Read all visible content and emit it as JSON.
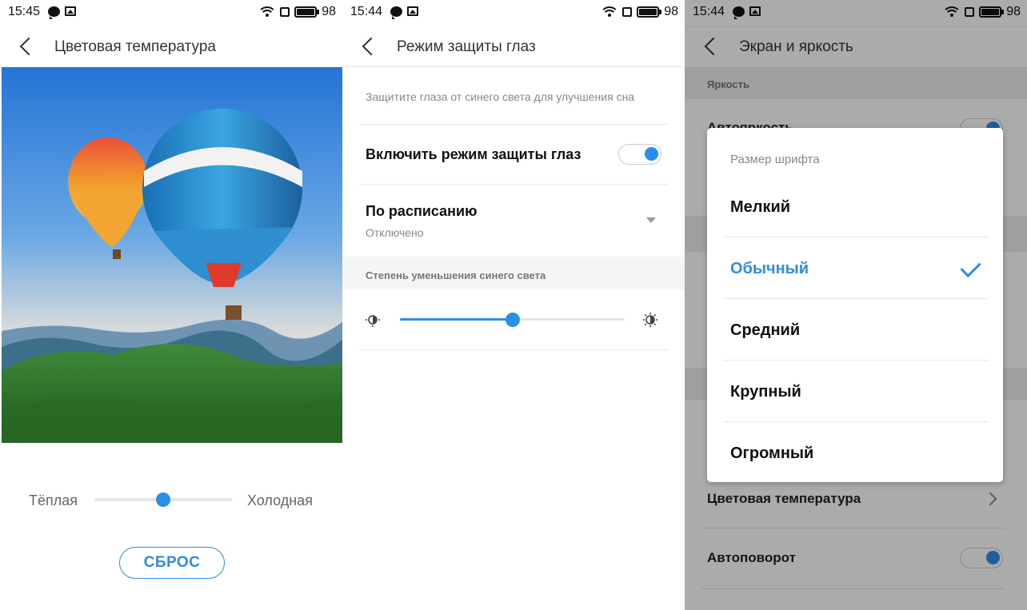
{
  "panel1": {
    "status": {
      "time": "15:45",
      "battery": "98"
    },
    "title": "Цветовая температура",
    "warm_label": "Тёплая",
    "cold_label": "Холодная",
    "temp_slider": 0.5,
    "reset_label": "СБРОС"
  },
  "panel2": {
    "status": {
      "time": "15:44",
      "battery": "98"
    },
    "title": "Режим защиты глаз",
    "description": "Защитите глаза от синего света для улучшения сна",
    "toggle_label": "Включить режим защиты глаз",
    "toggle_on": true,
    "schedule_label": "По расписанию",
    "schedule_value": "Отключено",
    "section_label": "Степень уменьшения синего света",
    "blue_slider": 0.5
  },
  "panel3": {
    "status": {
      "time": "15:44",
      "battery": "98"
    },
    "title": "Экран и яркость",
    "section_brightness": "Яркость",
    "row_auto_brightness": "Автояркость",
    "row_color_temp": "Цветовая температура",
    "row_autorotate": "Автоповорот",
    "dialog": {
      "title": "Размер шрифта",
      "options": [
        "Мелкий",
        "Обычный",
        "Средний",
        "Крупный",
        "Огромный"
      ],
      "selected": "Обычный"
    }
  },
  "colors": {
    "accent": "#2b8ee8"
  }
}
